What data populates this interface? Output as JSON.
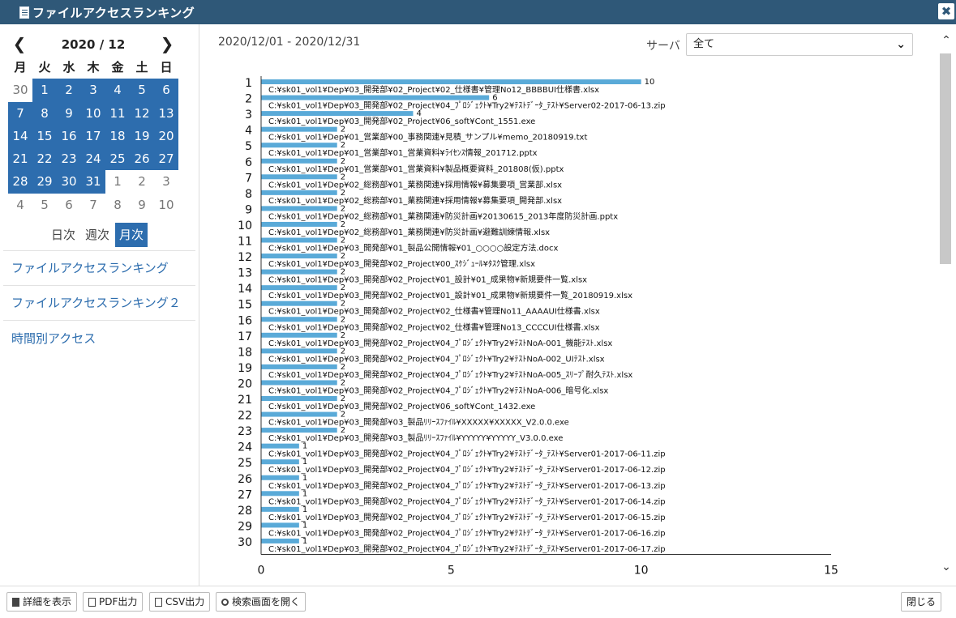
{
  "window": {
    "title": "ファイルアクセスランキング",
    "close_glyph": "✖"
  },
  "calendar": {
    "month_label": "2020 / 12",
    "prev_glyph": "❮",
    "next_glyph": "❯",
    "weekdays": [
      "月",
      "火",
      "水",
      "木",
      "金",
      "土",
      "日"
    ],
    "weeks": [
      [
        [
          "30",
          "other"
        ],
        [
          "1",
          "sel"
        ],
        [
          "2",
          "sel"
        ],
        [
          "3",
          "sel"
        ],
        [
          "4",
          "sel"
        ],
        [
          "5",
          "sel"
        ],
        [
          "6",
          "sel"
        ]
      ],
      [
        [
          "7",
          "sel"
        ],
        [
          "8",
          "sel"
        ],
        [
          "9",
          "sel"
        ],
        [
          "10",
          "sel"
        ],
        [
          "11",
          "sel"
        ],
        [
          "12",
          "sel"
        ],
        [
          "13",
          "sel"
        ]
      ],
      [
        [
          "14",
          "sel"
        ],
        [
          "15",
          "sel"
        ],
        [
          "16",
          "sel"
        ],
        [
          "17",
          "sel"
        ],
        [
          "18",
          "sel"
        ],
        [
          "19",
          "sel"
        ],
        [
          "20",
          "sel"
        ]
      ],
      [
        [
          "21",
          "sel"
        ],
        [
          "22",
          "sel"
        ],
        [
          "23",
          "sel"
        ],
        [
          "24",
          "sel"
        ],
        [
          "25",
          "sel"
        ],
        [
          "26",
          "sel"
        ],
        [
          "27",
          "sel"
        ]
      ],
      [
        [
          "28",
          "sel"
        ],
        [
          "29",
          "sel"
        ],
        [
          "30",
          "sel"
        ],
        [
          "31",
          "sel"
        ],
        [
          "1",
          "other"
        ],
        [
          "2",
          "other"
        ],
        [
          "3",
          "other"
        ]
      ],
      [
        [
          "4",
          "other"
        ],
        [
          "5",
          "other"
        ],
        [
          "6",
          "other"
        ],
        [
          "7",
          "other"
        ],
        [
          "8",
          "other"
        ],
        [
          "9",
          "other"
        ],
        [
          "10",
          "other"
        ]
      ]
    ]
  },
  "period": {
    "daily": "日次",
    "weekly": "週次",
    "monthly": "月次",
    "active": "monthly"
  },
  "nav": {
    "link1": "ファイルアクセスランキング",
    "link2": "ファイルアクセスランキング２",
    "link3": "時間別アクセス"
  },
  "main": {
    "date_range": "2020/12/01 - 2020/12/31",
    "server_label": "サーバ",
    "server_value": "全て"
  },
  "chart_data": {
    "type": "bar",
    "orientation": "horizontal",
    "bar_color": "#5aaad8",
    "xlim": [
      0,
      15
    ],
    "xticks": [
      0,
      5,
      10,
      15
    ],
    "ranks": [
      "1",
      "2",
      "3",
      "4",
      "5",
      "6",
      "7",
      "8",
      "9",
      "10",
      "11",
      "12",
      "13",
      "14",
      "15",
      "16",
      "17",
      "18",
      "19",
      "20",
      "21",
      "22",
      "23",
      "24",
      "25",
      "26",
      "27",
      "28",
      "29",
      "30"
    ],
    "categories": [
      "C:¥sk01_vol1¥Dep¥03_開発部¥02_Project¥02_仕様書¥管理No12_BBBBUI仕様書.xlsx",
      "C:¥sk01_vol1¥Dep¥03_開発部¥02_Project¥04_ﾌﾟﾛｼﾞｪｸﾄ¥Try2¥ﾃｽﾄﾃﾞｰﾀ_ﾃｽﾄ¥Server02-2017-06-13.zip",
      "C:¥sk01_vol1¥Dep¥03_開発部¥02_Project¥06_soft¥Cont_1551.exe",
      "C:¥sk01_vol1¥Dep¥01_営業部¥00_事務関連¥見積_サンプル¥memo_20180919.txt",
      "C:¥sk01_vol1¥Dep¥01_営業部¥01_営業資料¥ﾗｲｾﾝｽ情報_201712.pptx",
      "C:¥sk01_vol1¥Dep¥01_営業部¥01_営業資料¥製品概要資料_201808(仮).pptx",
      "C:¥sk01_vol1¥Dep¥02_総務部¥01_業務関連¥採用情報¥募集要項_営業部.xlsx",
      "C:¥sk01_vol1¥Dep¥02_総務部¥01_業務関連¥採用情報¥募集要項_開発部.xlsx",
      "C:¥sk01_vol1¥Dep¥02_総務部¥01_業務関連¥防災計画¥20130615_2013年度防災計画.pptx",
      "C:¥sk01_vol1¥Dep¥02_総務部¥01_業務関連¥防災計画¥避難訓練情報.xlsx",
      "C:¥sk01_vol1¥Dep¥03_開発部¥01_製品公開情報¥01_○○○○設定方法.docx",
      "C:¥sk01_vol1¥Dep¥03_開発部¥02_Project¥00_ｽｹｼﾞｭｰﾙ¥ﾀｽｸ管理.xlsx",
      "C:¥sk01_vol1¥Dep¥03_開発部¥02_Project¥01_設計¥01_成果物¥新規要件一覧.xlsx",
      "C:¥sk01_vol1¥Dep¥03_開発部¥02_Project¥01_設計¥01_成果物¥新規要件一覧_20180919.xlsx",
      "C:¥sk01_vol1¥Dep¥03_開発部¥02_Project¥02_仕様書¥管理No11_AAAAUI仕様書.xlsx",
      "C:¥sk01_vol1¥Dep¥03_開発部¥02_Project¥02_仕様書¥管理No13_CCCCUI仕様書.xlsx",
      "C:¥sk01_vol1¥Dep¥03_開発部¥02_Project¥04_ﾌﾟﾛｼﾞｪｸﾄ¥Try2¥ﾃｽﾄNoA-001_機能ﾃｽﾄ.xlsx",
      "C:¥sk01_vol1¥Dep¥03_開発部¥02_Project¥04_ﾌﾟﾛｼﾞｪｸﾄ¥Try2¥ﾃｽﾄNoA-002_UIﾃｽﾄ.xlsx",
      "C:¥sk01_vol1¥Dep¥03_開発部¥02_Project¥04_ﾌﾟﾛｼﾞｪｸﾄ¥Try2¥ﾃｽﾄNoA-005_ｽﾘｰﾌﾟ耐久ﾃｽﾄ.xlsx",
      "C:¥sk01_vol1¥Dep¥03_開発部¥02_Project¥04_ﾌﾟﾛｼﾞｪｸﾄ¥Try2¥ﾃｽﾄNoA-006_暗号化.xlsx",
      "C:¥sk01_vol1¥Dep¥03_開発部¥02_Project¥06_soft¥Cont_1432.exe",
      "C:¥sk01_vol1¥Dep¥03_開発部¥03_製品ﾘﾘｰｽﾌｧｲﾙ¥XXXXX¥XXXXX_V2.0.0.exe",
      "C:¥sk01_vol1¥Dep¥03_開発部¥03_製品ﾘﾘｰｽﾌｧｲﾙ¥YYYYY¥YYYYY_V3.0.0.exe",
      "C:¥sk01_vol1¥Dep¥03_開発部¥02_Project¥04_ﾌﾟﾛｼﾞｪｸﾄ¥Try2¥ﾃｽﾄﾃﾞｰﾀ_ﾃｽﾄ¥Server01-2017-06-11.zip",
      "C:¥sk01_vol1¥Dep¥03_開発部¥02_Project¥04_ﾌﾟﾛｼﾞｪｸﾄ¥Try2¥ﾃｽﾄﾃﾞｰﾀ_ﾃｽﾄ¥Server01-2017-06-12.zip",
      "C:¥sk01_vol1¥Dep¥03_開発部¥02_Project¥04_ﾌﾟﾛｼﾞｪｸﾄ¥Try2¥ﾃｽﾄﾃﾞｰﾀ_ﾃｽﾄ¥Server01-2017-06-13.zip",
      "C:¥sk01_vol1¥Dep¥03_開発部¥02_Project¥04_ﾌﾟﾛｼﾞｪｸﾄ¥Try2¥ﾃｽﾄﾃﾞｰﾀ_ﾃｽﾄ¥Server01-2017-06-14.zip",
      "C:¥sk01_vol1¥Dep¥03_開発部¥02_Project¥04_ﾌﾟﾛｼﾞｪｸﾄ¥Try2¥ﾃｽﾄﾃﾞｰﾀ_ﾃｽﾄ¥Server01-2017-06-15.zip",
      "C:¥sk01_vol1¥Dep¥03_開発部¥02_Project¥04_ﾌﾟﾛｼﾞｪｸﾄ¥Try2¥ﾃｽﾄﾃﾞｰﾀ_ﾃｽﾄ¥Server01-2017-06-16.zip",
      "C:¥sk01_vol1¥Dep¥03_開発部¥02_Project¥04_ﾌﾟﾛｼﾞｪｸﾄ¥Try2¥ﾃｽﾄﾃﾞｰﾀ_ﾃｽﾄ¥Server01-2017-06-17.zip"
    ],
    "values": [
      10,
      6,
      4,
      2,
      2,
      2,
      2,
      2,
      2,
      2,
      2,
      2,
      2,
      2,
      2,
      2,
      2,
      2,
      2,
      2,
      2,
      2,
      2,
      1,
      1,
      1,
      1,
      1,
      1,
      1
    ]
  },
  "footer": {
    "details": "詳細を表示",
    "pdf": "PDF出力",
    "csv": "CSV出力",
    "search": "検索画面を開く",
    "close": "閉じる"
  }
}
